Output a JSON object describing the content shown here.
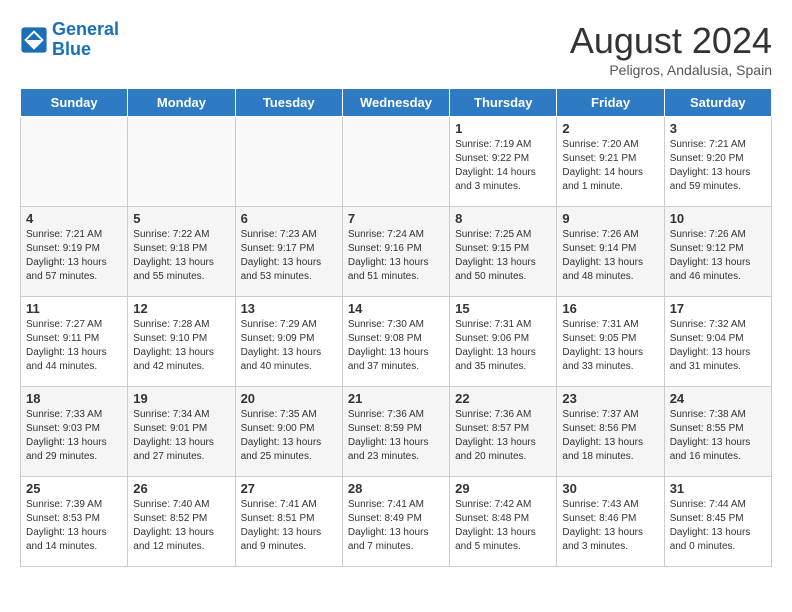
{
  "logo": {
    "line1": "General",
    "line2": "Blue"
  },
  "title": "August 2024",
  "location": "Peligros, Andalusia, Spain",
  "days_of_week": [
    "Sunday",
    "Monday",
    "Tuesday",
    "Wednesday",
    "Thursday",
    "Friday",
    "Saturday"
  ],
  "weeks": [
    [
      {
        "day": "",
        "info": ""
      },
      {
        "day": "",
        "info": ""
      },
      {
        "day": "",
        "info": ""
      },
      {
        "day": "",
        "info": ""
      },
      {
        "day": "1",
        "info": "Sunrise: 7:19 AM\nSunset: 9:22 PM\nDaylight: 14 hours\nand 3 minutes."
      },
      {
        "day": "2",
        "info": "Sunrise: 7:20 AM\nSunset: 9:21 PM\nDaylight: 14 hours\nand 1 minute."
      },
      {
        "day": "3",
        "info": "Sunrise: 7:21 AM\nSunset: 9:20 PM\nDaylight: 13 hours\nand 59 minutes."
      }
    ],
    [
      {
        "day": "4",
        "info": "Sunrise: 7:21 AM\nSunset: 9:19 PM\nDaylight: 13 hours\nand 57 minutes."
      },
      {
        "day": "5",
        "info": "Sunrise: 7:22 AM\nSunset: 9:18 PM\nDaylight: 13 hours\nand 55 minutes."
      },
      {
        "day": "6",
        "info": "Sunrise: 7:23 AM\nSunset: 9:17 PM\nDaylight: 13 hours\nand 53 minutes."
      },
      {
        "day": "7",
        "info": "Sunrise: 7:24 AM\nSunset: 9:16 PM\nDaylight: 13 hours\nand 51 minutes."
      },
      {
        "day": "8",
        "info": "Sunrise: 7:25 AM\nSunset: 9:15 PM\nDaylight: 13 hours\nand 50 minutes."
      },
      {
        "day": "9",
        "info": "Sunrise: 7:26 AM\nSunset: 9:14 PM\nDaylight: 13 hours\nand 48 minutes."
      },
      {
        "day": "10",
        "info": "Sunrise: 7:26 AM\nSunset: 9:12 PM\nDaylight: 13 hours\nand 46 minutes."
      }
    ],
    [
      {
        "day": "11",
        "info": "Sunrise: 7:27 AM\nSunset: 9:11 PM\nDaylight: 13 hours\nand 44 minutes."
      },
      {
        "day": "12",
        "info": "Sunrise: 7:28 AM\nSunset: 9:10 PM\nDaylight: 13 hours\nand 42 minutes."
      },
      {
        "day": "13",
        "info": "Sunrise: 7:29 AM\nSunset: 9:09 PM\nDaylight: 13 hours\nand 40 minutes."
      },
      {
        "day": "14",
        "info": "Sunrise: 7:30 AM\nSunset: 9:08 PM\nDaylight: 13 hours\nand 37 minutes."
      },
      {
        "day": "15",
        "info": "Sunrise: 7:31 AM\nSunset: 9:06 PM\nDaylight: 13 hours\nand 35 minutes."
      },
      {
        "day": "16",
        "info": "Sunrise: 7:31 AM\nSunset: 9:05 PM\nDaylight: 13 hours\nand 33 minutes."
      },
      {
        "day": "17",
        "info": "Sunrise: 7:32 AM\nSunset: 9:04 PM\nDaylight: 13 hours\nand 31 minutes."
      }
    ],
    [
      {
        "day": "18",
        "info": "Sunrise: 7:33 AM\nSunset: 9:03 PM\nDaylight: 13 hours\nand 29 minutes."
      },
      {
        "day": "19",
        "info": "Sunrise: 7:34 AM\nSunset: 9:01 PM\nDaylight: 13 hours\nand 27 minutes."
      },
      {
        "day": "20",
        "info": "Sunrise: 7:35 AM\nSunset: 9:00 PM\nDaylight: 13 hours\nand 25 minutes."
      },
      {
        "day": "21",
        "info": "Sunrise: 7:36 AM\nSunset: 8:59 PM\nDaylight: 13 hours\nand 23 minutes."
      },
      {
        "day": "22",
        "info": "Sunrise: 7:36 AM\nSunset: 8:57 PM\nDaylight: 13 hours\nand 20 minutes."
      },
      {
        "day": "23",
        "info": "Sunrise: 7:37 AM\nSunset: 8:56 PM\nDaylight: 13 hours\nand 18 minutes."
      },
      {
        "day": "24",
        "info": "Sunrise: 7:38 AM\nSunset: 8:55 PM\nDaylight: 13 hours\nand 16 minutes."
      }
    ],
    [
      {
        "day": "25",
        "info": "Sunrise: 7:39 AM\nSunset: 8:53 PM\nDaylight: 13 hours\nand 14 minutes."
      },
      {
        "day": "26",
        "info": "Sunrise: 7:40 AM\nSunset: 8:52 PM\nDaylight: 13 hours\nand 12 minutes."
      },
      {
        "day": "27",
        "info": "Sunrise: 7:41 AM\nSunset: 8:51 PM\nDaylight: 13 hours\nand 9 minutes."
      },
      {
        "day": "28",
        "info": "Sunrise: 7:41 AM\nSunset: 8:49 PM\nDaylight: 13 hours\nand 7 minutes."
      },
      {
        "day": "29",
        "info": "Sunrise: 7:42 AM\nSunset: 8:48 PM\nDaylight: 13 hours\nand 5 minutes."
      },
      {
        "day": "30",
        "info": "Sunrise: 7:43 AM\nSunset: 8:46 PM\nDaylight: 13 hours\nand 3 minutes."
      },
      {
        "day": "31",
        "info": "Sunrise: 7:44 AM\nSunset: 8:45 PM\nDaylight: 13 hours\nand 0 minutes."
      }
    ]
  ]
}
